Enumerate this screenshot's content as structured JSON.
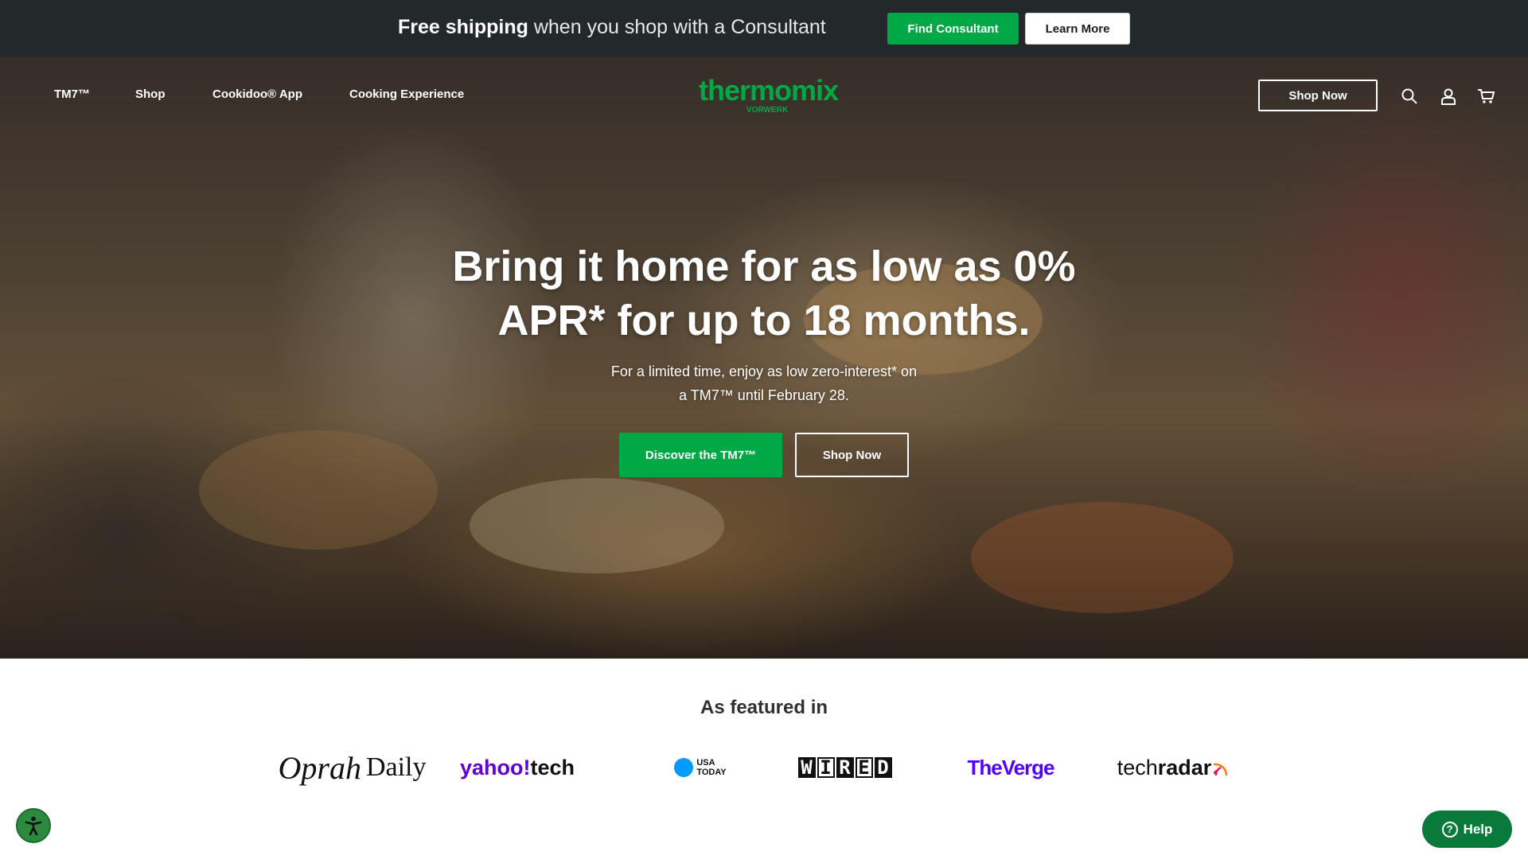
{
  "promo": {
    "bold": "Free shipping",
    "rest": " when you shop with a Consultant",
    "find_label": "Find Consultant",
    "learn_label": "Learn More"
  },
  "nav": {
    "items": [
      {
        "label": "TM7™"
      },
      {
        "label": "Shop"
      },
      {
        "label": "Cookidoo® App"
      },
      {
        "label": "Cooking Experience"
      }
    ],
    "logo_text": "thermomix",
    "logo_sub": "VORWERK",
    "shop_now_label": "Shop Now",
    "icons": [
      "search-icon",
      "account-icon",
      "cart-icon"
    ]
  },
  "hero": {
    "headline_line1": "Bring it home for as low as 0%",
    "headline_line2": "APR* for up to 18 months.",
    "sub_line1": "For a limited time, enjoy as low zero-interest* on",
    "sub_line2": "a TM7™ until February 28.",
    "discover_label": "Discover the TM7™",
    "shop_label": "Shop Now"
  },
  "featured": {
    "title": "As featured in",
    "logos": {
      "oprah_script": "Oprah",
      "oprah_word": "Daily",
      "yahoo_a": "yahoo",
      "yahoo_slash": "!",
      "yahoo_b": "tech",
      "usa_top": "USA",
      "usa_bottom": "TODAY",
      "wired": [
        "W",
        "I",
        "R",
        "E",
        "D"
      ],
      "verge": "TheVerge",
      "techradar_a": "tech",
      "techradar_b": "radar"
    }
  },
  "widgets": {
    "help_label": "Help"
  },
  "colors": {
    "brand_green": "#00a846",
    "promo_bg": "#23282b",
    "help_green": "#0a7a3a"
  }
}
